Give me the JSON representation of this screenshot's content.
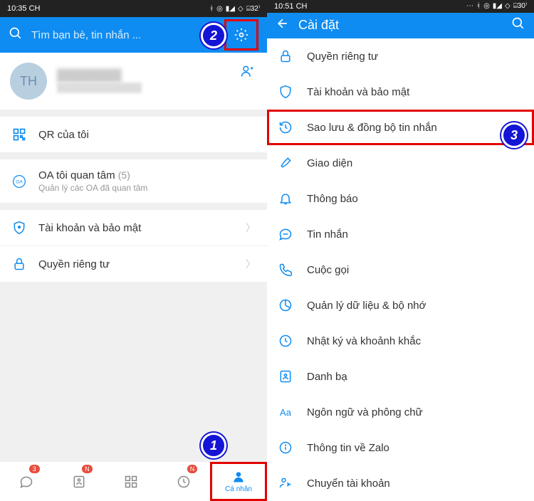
{
  "left": {
    "status_time": "10:35 CH",
    "status_battery": "32",
    "search_placeholder": "Tìm bạn bè, tin nhắn ...",
    "profile": {
      "initials": "TH",
      "name": "████████",
      "sub": "██████████████"
    },
    "qr_label": "QR của tôi",
    "oa": {
      "title": "OA tôi quan tâm",
      "count": "(5)",
      "sub": "Quản lý các OA đã quan tâm"
    },
    "security_label": "Tài khoản và bảo mật",
    "privacy_label": "Quyền riêng tư",
    "nav": {
      "messages_badge": "3",
      "contacts_badge": "N",
      "timeline_badge": "N",
      "personal": "Cá nhân"
    }
  },
  "right": {
    "status_time": "10:51 CH",
    "status_battery": "30",
    "title": "Cài đặt",
    "items": {
      "privacy": "Quyền riêng tư",
      "security": "Tài khoản và bảo mật",
      "backup": "Sao lưu & đồng bộ tin nhắn",
      "ui": "Giao diện",
      "notif": "Thông báo",
      "message": "Tin nhắn",
      "call": "Cuộc gọi",
      "data": "Quản lý dữ liệu & bộ nhớ",
      "diary": "Nhật ký và khoảnh khắc",
      "contacts": "Danh bạ",
      "lang": "Ngôn ngữ và phông chữ",
      "about": "Thông tin về Zalo",
      "switch": "Chuyển tài khoản"
    }
  },
  "callouts": {
    "one": "1",
    "two": "2",
    "three": "3"
  }
}
